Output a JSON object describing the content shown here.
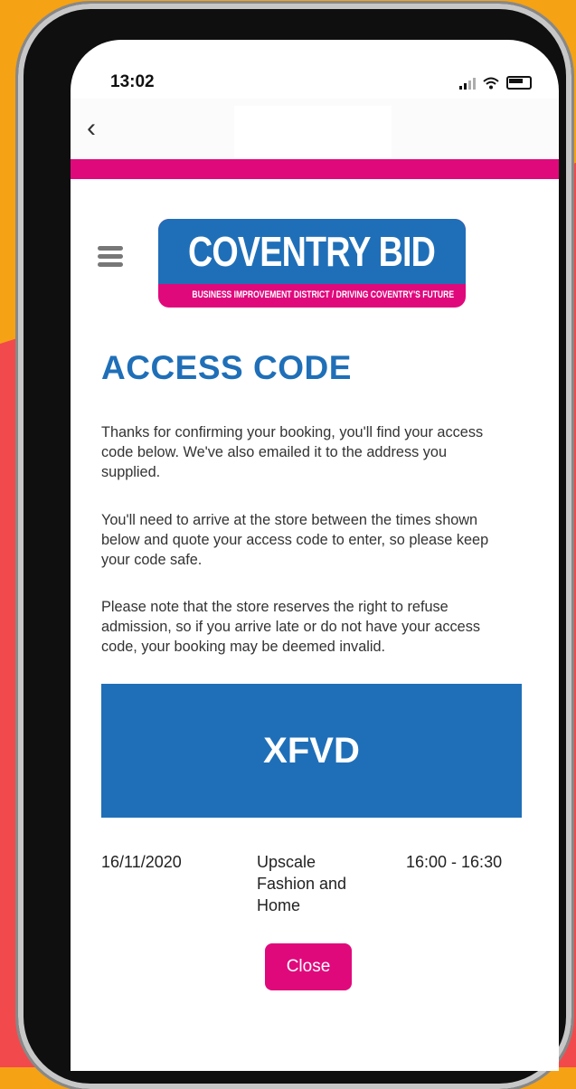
{
  "status_bar": {
    "time": "13:02"
  },
  "nav": {
    "back_icon": "chevron-left-icon"
  },
  "logo": {
    "main_text": "COVENTRY BID",
    "subtitle": "BUSINESS IMPROVEMENT DISTRICT / DRIVING COVENTRY'S FUTURE"
  },
  "page": {
    "title": "ACCESS CODE",
    "paragraphs": [
      "Thanks for confirming your booking, you'll find your access code below. We've also emailed it to the address you supplied.",
      "You'll need to arrive at the store between the times shown below and quote your access code to enter, so please keep your code safe.",
      "Please note that the store reserves the right to refuse admission, so if you arrive late or do not have your access code, your booking may be deemed invalid."
    ]
  },
  "booking": {
    "code": "XFVD",
    "date": "16/11/2020",
    "store": "Upscale Fashion and Home",
    "time_slot": "16:00 - 16:30"
  },
  "actions": {
    "close_label": "Close"
  },
  "colors": {
    "brand_blue": "#1f6fb8",
    "brand_pink": "#e0097c",
    "background_orange": "#f5a214",
    "background_red": "#f24a4c"
  }
}
